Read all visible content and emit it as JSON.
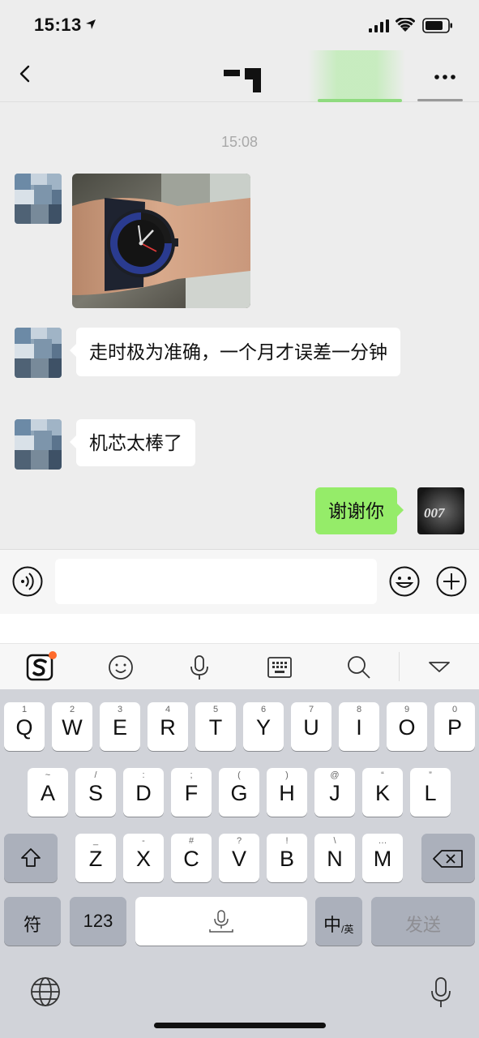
{
  "status_bar": {
    "time": "15:13"
  },
  "chat": {
    "timestamp": "15:08",
    "messages": [
      {
        "type": "image",
        "side": "left",
        "content": "wristwatch-photo"
      },
      {
        "type": "text",
        "side": "left",
        "text": "走时极为准确，一个月才误差一分钟"
      },
      {
        "type": "text",
        "side": "left",
        "text": "机芯太棒了"
      },
      {
        "type": "text",
        "side": "right",
        "text": "谢谢你"
      }
    ],
    "my_avatar_text": "007"
  },
  "input_bar": {
    "value": "",
    "placeholder": ""
  },
  "ime_toolbar": {
    "tools": [
      "sogou-logo-icon",
      "emoji-icon",
      "microphone-icon",
      "keyboard-icon",
      "search-icon",
      "collapse-keyboard-icon"
    ]
  },
  "keyboard": {
    "row1": [
      {
        "key": "Q",
        "hint": "1"
      },
      {
        "key": "W",
        "hint": "2"
      },
      {
        "key": "E",
        "hint": "3"
      },
      {
        "key": "R",
        "hint": "4"
      },
      {
        "key": "T",
        "hint": "5"
      },
      {
        "key": "Y",
        "hint": "6"
      },
      {
        "key": "U",
        "hint": "7"
      },
      {
        "key": "I",
        "hint": "8"
      },
      {
        "key": "O",
        "hint": "9"
      },
      {
        "key": "P",
        "hint": "0"
      }
    ],
    "row2": [
      {
        "key": "A",
        "hint": "~"
      },
      {
        "key": "S",
        "hint": "/"
      },
      {
        "key": "D",
        "hint": ":"
      },
      {
        "key": "F",
        "hint": ";"
      },
      {
        "key": "G",
        "hint": "("
      },
      {
        "key": "H",
        "hint": ")"
      },
      {
        "key": "J",
        "hint": "@"
      },
      {
        "key": "K",
        "hint": "“"
      },
      {
        "key": "L",
        "hint": "”"
      }
    ],
    "row3": [
      {
        "key": "Z",
        "hint": "_"
      },
      {
        "key": "X",
        "hint": "-"
      },
      {
        "key": "C",
        "hint": "#"
      },
      {
        "key": "V",
        "hint": "?"
      },
      {
        "key": "B",
        "hint": "!"
      },
      {
        "key": "N",
        "hint": "\\"
      },
      {
        "key": "M",
        "hint": "…"
      }
    ],
    "symbols_label": "符",
    "numbers_label": "123",
    "lang_main": "中",
    "lang_sub": "/英",
    "send_label": "发送"
  },
  "colors": {
    "my_bubble": "#95ec69",
    "their_bubble": "#ffffff",
    "background": "#ededed",
    "ime_badge": "#ff6a2b"
  }
}
